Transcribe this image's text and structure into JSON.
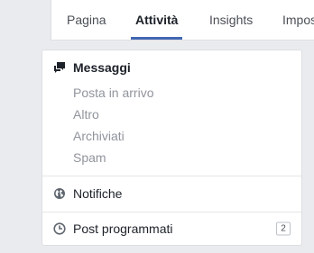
{
  "tabs": [
    {
      "label": "Pagina",
      "active": false
    },
    {
      "label": "Attività",
      "active": true
    },
    {
      "label": "Insights",
      "active": false
    },
    {
      "label": "Impos",
      "active": false
    }
  ],
  "messages": {
    "title": "Messaggi",
    "icon": "chat-bubbles-icon",
    "items": [
      "Posta in arrivo",
      "Altro",
      "Archiviati",
      "Spam"
    ]
  },
  "notifications": {
    "label": "Notifiche",
    "icon": "globe-icon"
  },
  "scheduled": {
    "label": "Post programmati",
    "icon": "clock-icon",
    "count": "2"
  },
  "colors": {
    "accent": "#4267b2",
    "background": "#e9ebee",
    "muted_text": "#90949c"
  }
}
